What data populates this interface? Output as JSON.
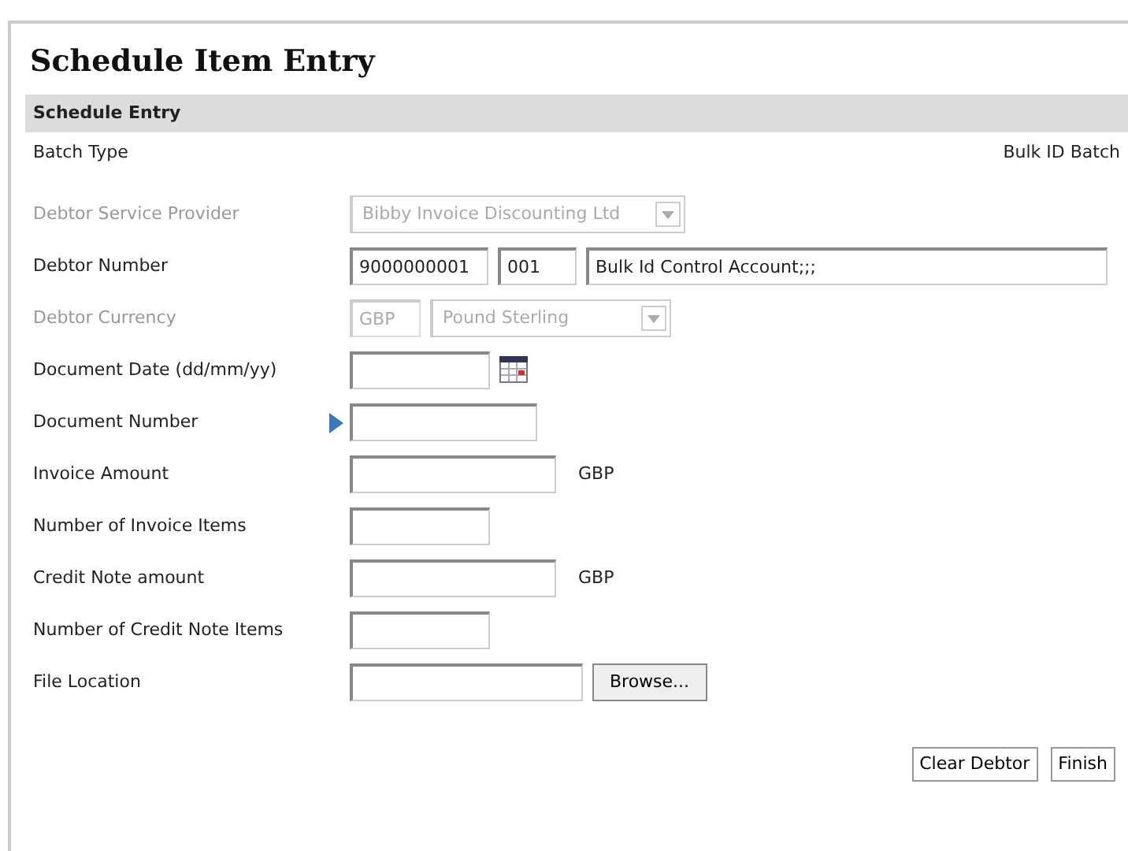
{
  "title": "Schedule Item Entry",
  "section": {
    "title": "Schedule Entry",
    "batch_label": "Batch Type",
    "batch_value": "Bulk ID Batch"
  },
  "rows": [
    {
      "label": "Debtor Service Provider",
      "disabled": true,
      "controls": [
        {
          "kind": "select",
          "value": "Bibby Invoice Discounting Ltd"
        }
      ]
    },
    {
      "label": "Debtor Number",
      "disabled": false,
      "controls": [
        {
          "kind": "input",
          "value": "9000000001"
        },
        {
          "kind": "input",
          "value": "001"
        },
        {
          "kind": "input",
          "value": "Bulk Id Control Account;;;"
        }
      ]
    },
    {
      "label": "Debtor Currency",
      "disabled": true,
      "controls": [
        {
          "kind": "input",
          "value": "GBP"
        },
        {
          "kind": "select",
          "value": "Pound Sterling"
        }
      ]
    },
    {
      "label": "Document Date (dd/mm/yy)",
      "disabled": false,
      "controls": [
        {
          "kind": "input"
        },
        {
          "kind": "calendar"
        }
      ]
    },
    {
      "label": "Document Number",
      "disabled": false,
      "controls": [
        {
          "kind": "marker"
        },
        {
          "kind": "input"
        }
      ]
    },
    {
      "label": "Invoice Amount",
      "disabled": false,
      "controls": [
        {
          "kind": "input"
        },
        {
          "kind": "unit",
          "value": "GBP"
        }
      ]
    },
    {
      "label": "Number of Invoice Items",
      "disabled": false,
      "controls": [
        {
          "kind": "input"
        }
      ]
    },
    {
      "label": "Credit Note amount",
      "disabled": false,
      "controls": [
        {
          "kind": "input"
        },
        {
          "kind": "unit",
          "value": "GBP"
        }
      ]
    },
    {
      "label": "Number of Credit Note Items",
      "disabled": false,
      "controls": [
        {
          "kind": "input"
        }
      ]
    },
    {
      "label": "File Location",
      "disabled": false,
      "controls": [
        {
          "kind": "input"
        },
        {
          "kind": "button",
          "value": "Browse..."
        }
      ]
    }
  ],
  "buttons": [
    "Clear Debtor",
    "Finish"
  ]
}
